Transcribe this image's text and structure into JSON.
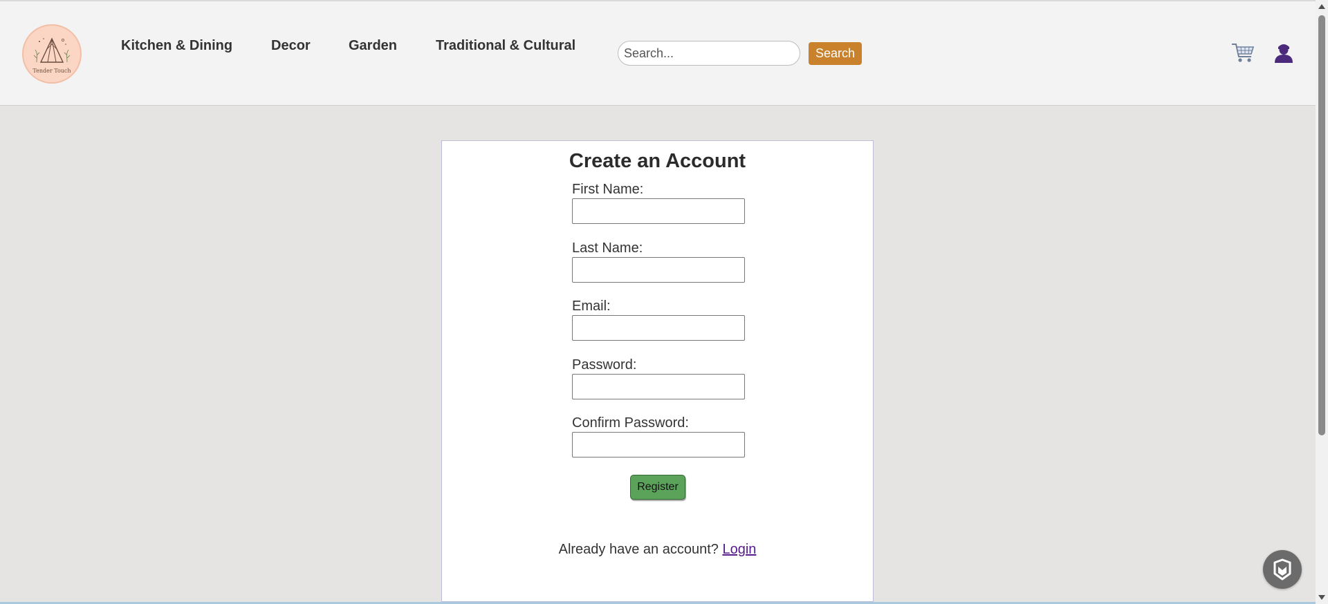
{
  "header": {
    "logo": {
      "text": "Tender Touch",
      "icon": "tent-logo-icon"
    },
    "nav": [
      {
        "label": "Kitchen & Dining"
      },
      {
        "label": "Decor"
      },
      {
        "label": "Garden"
      },
      {
        "label": "Traditional & Cultural"
      }
    ],
    "search": {
      "placeholder": "Search...",
      "value": "",
      "button_label": "Search"
    },
    "icons": {
      "cart": "cart-icon",
      "user": "user-icon"
    },
    "colors": {
      "background": "#f3f3f3",
      "search_button": "#c9812c",
      "user_icon": "#4b2a7b"
    }
  },
  "form": {
    "title": "Create an Account",
    "fields": [
      {
        "label": "First Name:",
        "value": ""
      },
      {
        "label": "Last Name:",
        "value": ""
      },
      {
        "label": "Email:",
        "value": ""
      },
      {
        "label": "Password:",
        "value": ""
      },
      {
        "label": "Confirm Password:",
        "value": ""
      }
    ],
    "register_label": "Register",
    "login_prompt": "Already have an account?",
    "login_link": "Login",
    "colors": {
      "register_button": "#5ba35b",
      "link": "#551a8b"
    }
  },
  "widgets": {
    "chat": "chat-widget-icon"
  },
  "page": {
    "background": "#e5e4e2"
  }
}
